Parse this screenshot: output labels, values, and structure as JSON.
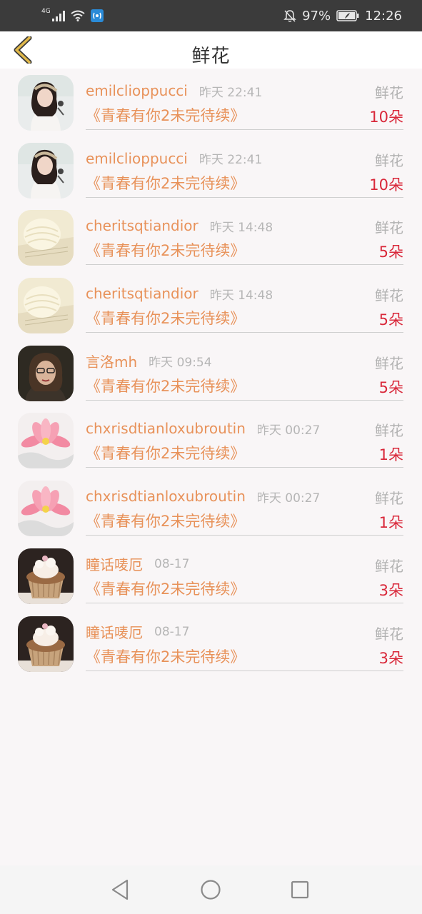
{
  "status_bar": {
    "network": "4G",
    "battery": "97%",
    "time": "12:26"
  },
  "header": {
    "title": "鲜花"
  },
  "records": [
    {
      "name": "emilclioppucci",
      "time": "昨天 22:41",
      "gift": "鲜花",
      "work": "《青春有你2未完待续》",
      "count": "10朵",
      "avatar": "woman-avatar"
    },
    {
      "name": "emilclioppucci",
      "time": "昨天 22:41",
      "gift": "鲜花",
      "work": "《青春有你2未完待续》",
      "count": "10朵",
      "avatar": "woman-avatar"
    },
    {
      "name": "cheritsqtiandior",
      "time": "昨天 14:48",
      "gift": "鲜花",
      "work": "《青春有你2未完待续》",
      "count": "5朵",
      "avatar": "yarn-avatar"
    },
    {
      "name": "cheritsqtiandior",
      "time": "昨天 14:48",
      "gift": "鲜花",
      "work": "《青春有你2未完待续》",
      "count": "5朵",
      "avatar": "yarn-avatar"
    },
    {
      "name": "言洛mh",
      "time": "昨天 09:54",
      "gift": "鲜花",
      "work": "《青春有你2未完待续》",
      "count": "5朵",
      "avatar": "portrait-avatar"
    },
    {
      "name": "chxrisdtianloxubroutin",
      "time": "昨天 00:27",
      "gift": "鲜花",
      "work": "《青春有你2未完待续》",
      "count": "1朵",
      "avatar": "lotus-avatar"
    },
    {
      "name": "chxrisdtianloxubroutin",
      "time": "昨天 00:27",
      "gift": "鲜花",
      "work": "《青春有你2未完待续》",
      "count": "1朵",
      "avatar": "lotus-avatar"
    },
    {
      "name": "瞳话唛厄",
      "time": "08-17",
      "gift": "鲜花",
      "work": "《青春有你2未完待续》",
      "count": "3朵",
      "avatar": "cupcake-avatar"
    },
    {
      "name": "瞳话唛厄",
      "time": "08-17",
      "gift": "鲜花",
      "work": "《青春有你2未完待续》",
      "count": "3朵",
      "avatar": "cupcake-avatar"
    }
  ],
  "colors": {
    "name": "#e8925a",
    "count": "#d9283a",
    "muted": "#b2b2b2",
    "back_arrow": "#e0b84a"
  }
}
